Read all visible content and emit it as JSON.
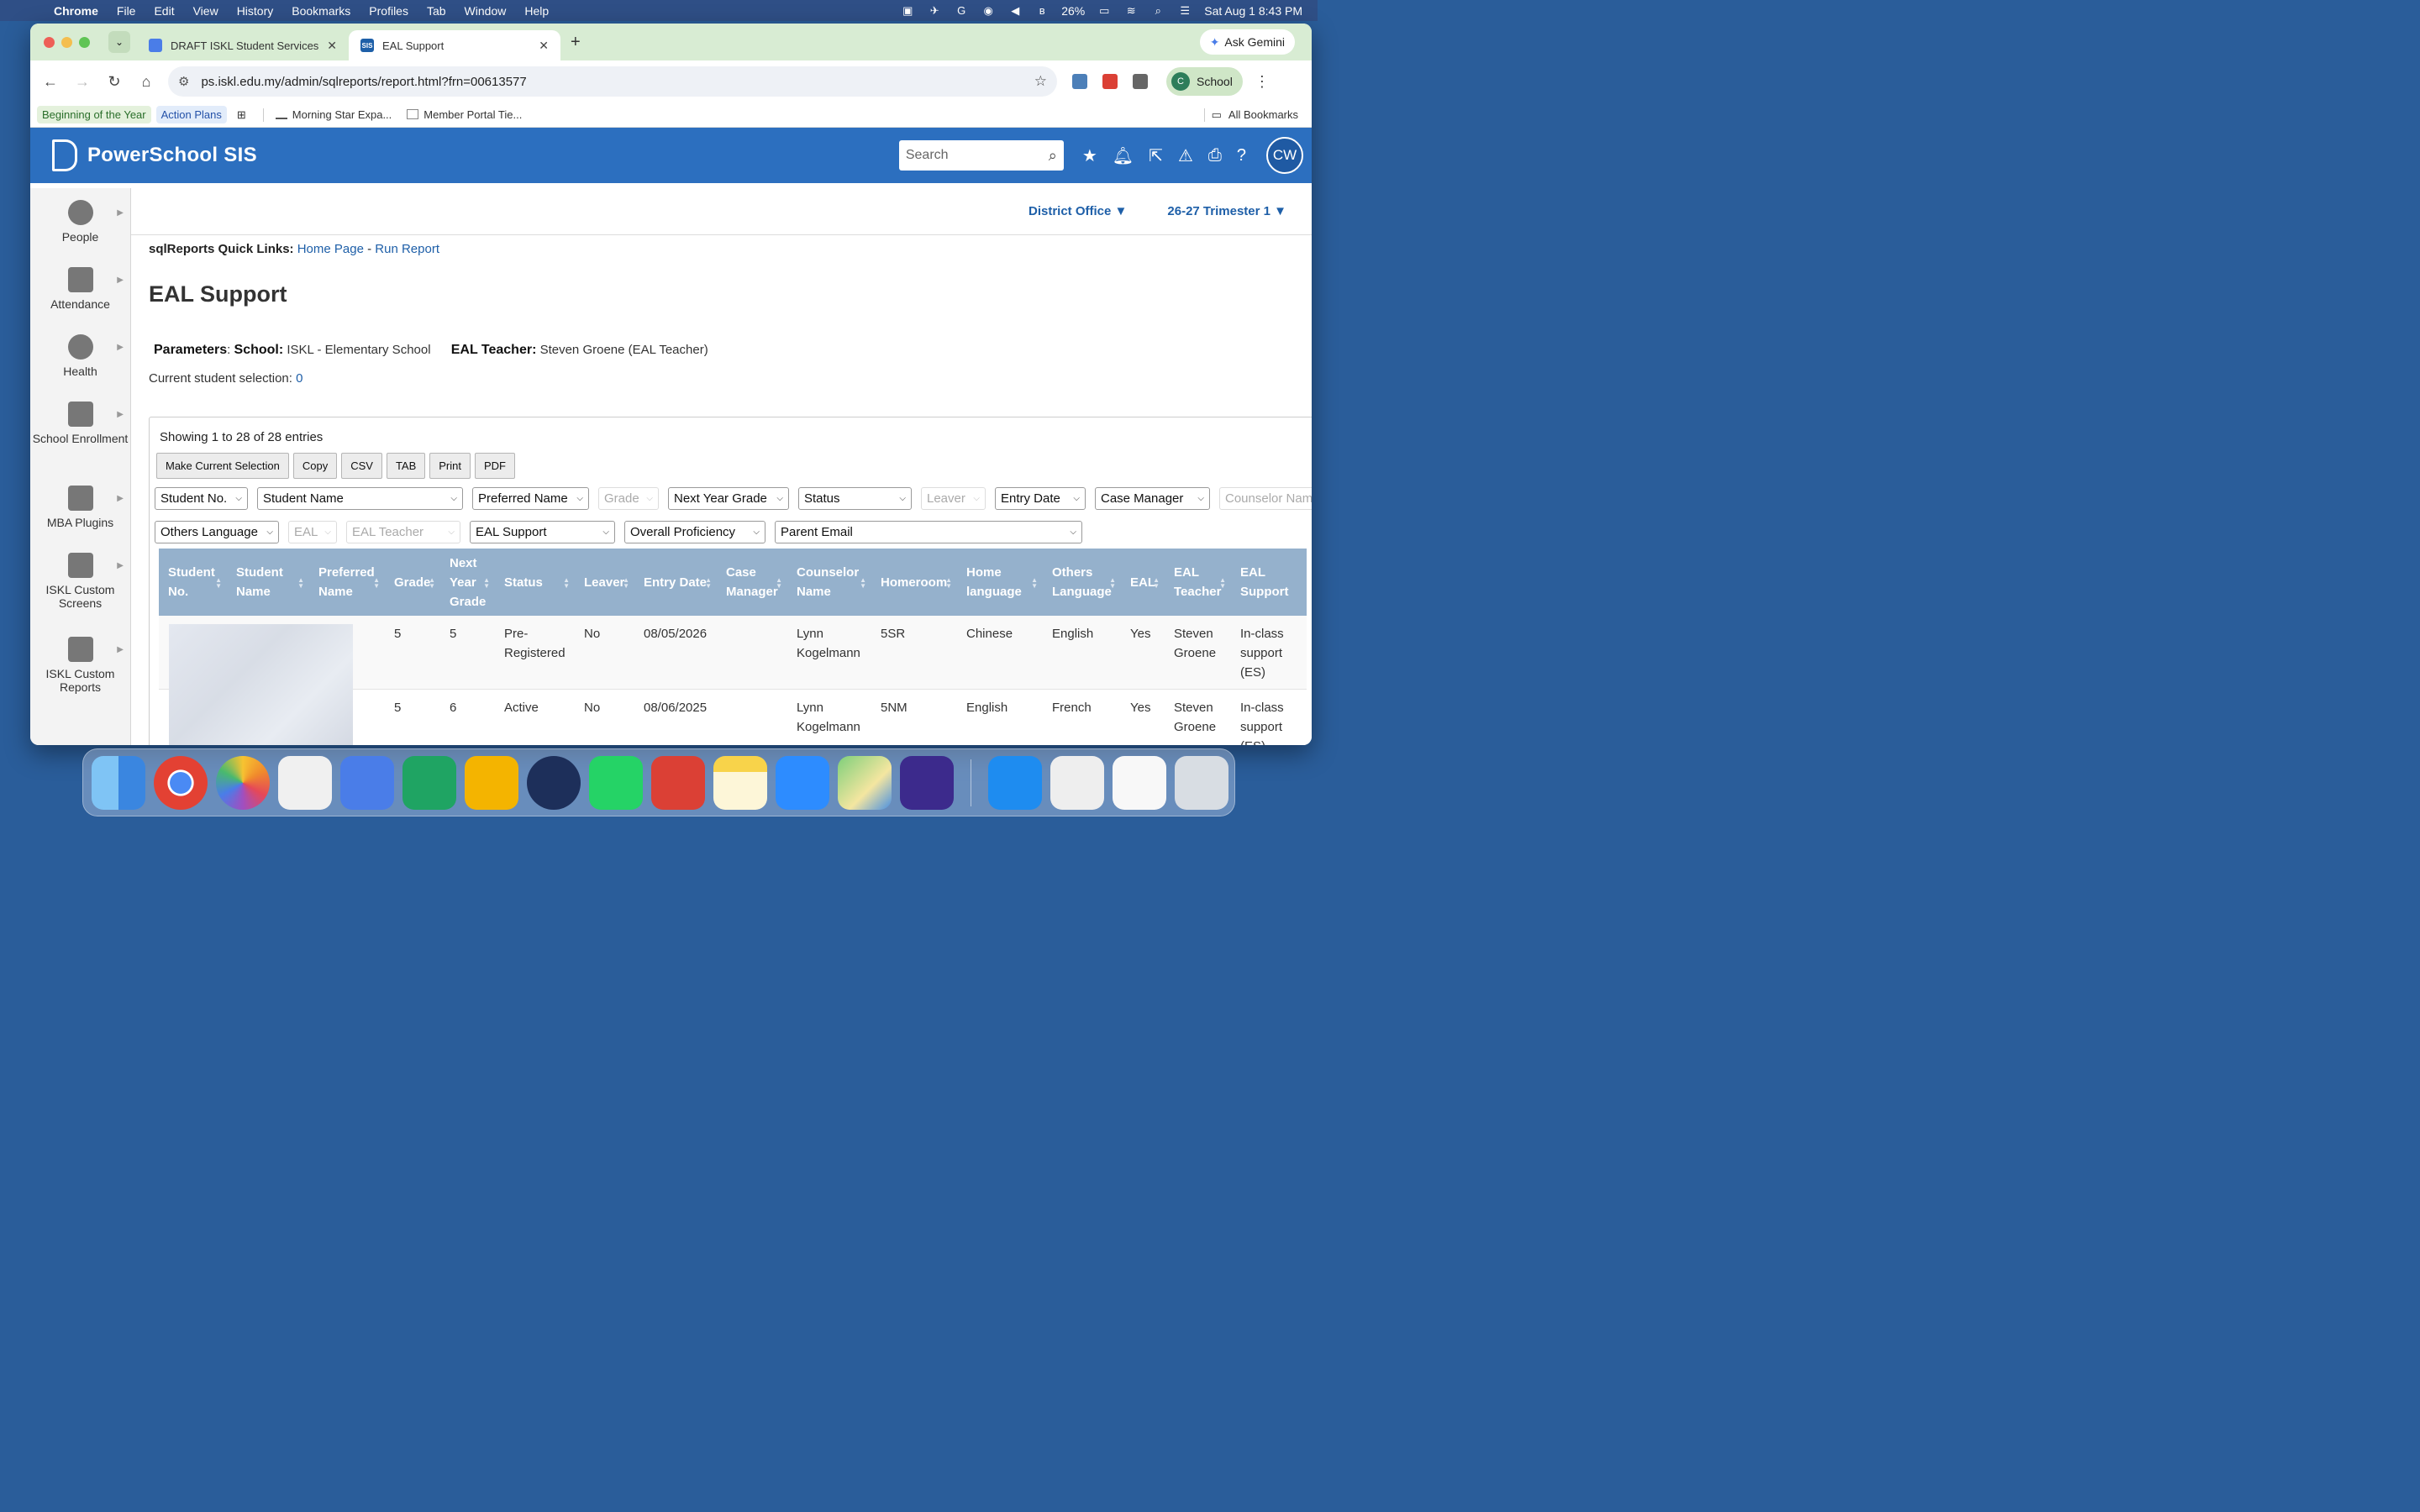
{
  "menubar": {
    "app": "Chrome",
    "items": [
      "File",
      "Edit",
      "View",
      "History",
      "Bookmarks",
      "Profiles",
      "Tab",
      "Window",
      "Help"
    ],
    "battery": "26%",
    "datetime": "Sat Aug 1  8:43 PM"
  },
  "browser": {
    "tabs": [
      {
        "title": "DRAFT ISKL Student Services",
        "favicon_color": "#4a7de8"
      },
      {
        "title": "EAL Support",
        "favicon_label": "SIS",
        "favicon_color": "#1e5fa8"
      }
    ],
    "ask_gemini": "Ask Gemini",
    "url": "ps.iskl.edu.my/admin/sqlreports/report.html?frn=00613577",
    "profile": {
      "initial": "C",
      "label": "School"
    },
    "bookmarks": [
      "Beginning of the Year",
      "Action Plans",
      "Morning Star Expa...",
      "Member Portal Tie..."
    ],
    "all_bookmarks": "All Bookmarks"
  },
  "ps": {
    "brand": "PowerSchool SIS",
    "search_placeholder": "Search",
    "user_initials": "CW",
    "district": "District Office",
    "term": "26-27 Trimester 1"
  },
  "sidebar": {
    "items": [
      {
        "label": "People"
      },
      {
        "label": "Attendance"
      },
      {
        "label": "Health"
      },
      {
        "label": "School Enrollment"
      },
      {
        "label": "MBA Plugins"
      },
      {
        "label": "ISKL Custom Screens"
      },
      {
        "label": "ISKL Custom Reports"
      }
    ]
  },
  "report": {
    "quicklinks_label": "sqlReports Quick Links:",
    "home_link": "Home Page",
    "separator": "-",
    "run_link": "Run Report",
    "title": "EAL Support",
    "params_label": "Parameters",
    "school_label": "School:",
    "school_value": "ISKL - Elementary School",
    "teacher_label": "EAL Teacher:",
    "teacher_value": "Steven Groene (EAL Teacher)",
    "selection_label": "Current student selection:",
    "selection_count": "0",
    "showing": "Showing 1 to 28 of 28 entries",
    "buttons": [
      "Make Current Selection",
      "Copy",
      "CSV",
      "TAB",
      "Print",
      "PDF"
    ],
    "filters_row1": [
      "Student No.",
      "Student Name",
      "Preferred Name",
      "Grade",
      "Next Year Grade",
      "Status",
      "Leaver",
      "Entry Date",
      "Case Manager",
      "Counselor Nam"
    ],
    "filters_row2": [
      "Others Language",
      "EAL",
      "EAL Teacher",
      "EAL Support",
      "Overall Proficiency",
      "Parent Email"
    ],
    "columns": [
      "Student No.",
      "Student Name",
      "Preferred Name",
      "Grade",
      "Next Year Grade",
      "Status",
      "Leaver",
      "Entry Date",
      "Case Manager",
      "Counselor Name",
      "Homeroom",
      "Home language",
      "Others Language",
      "EAL",
      "EAL Teacher",
      "EAL Support"
    ],
    "rows": [
      {
        "grade": "5",
        "next_grade": "5",
        "status": "Pre-Registered",
        "leaver": "No",
        "entry": "08/05/2026",
        "case_mgr": "",
        "counselor": "Lynn Kogelmann",
        "homeroom": "5SR",
        "home_lang": "Chinese",
        "other_lang": "English",
        "eal": "Yes",
        "eal_teacher": "Steven Groene",
        "eal_support": "In-class support (ES)"
      },
      {
        "grade": "5",
        "next_grade": "6",
        "status": "Active",
        "leaver": "No",
        "entry": "08/06/2025",
        "case_mgr": "",
        "counselor": "Lynn Kogelmann",
        "homeroom": "5NM",
        "home_lang": "English",
        "other_lang": "French",
        "eal": "Yes",
        "eal_teacher": "Steven Groene",
        "eal_support": "In-class support (ES)"
      }
    ]
  }
}
